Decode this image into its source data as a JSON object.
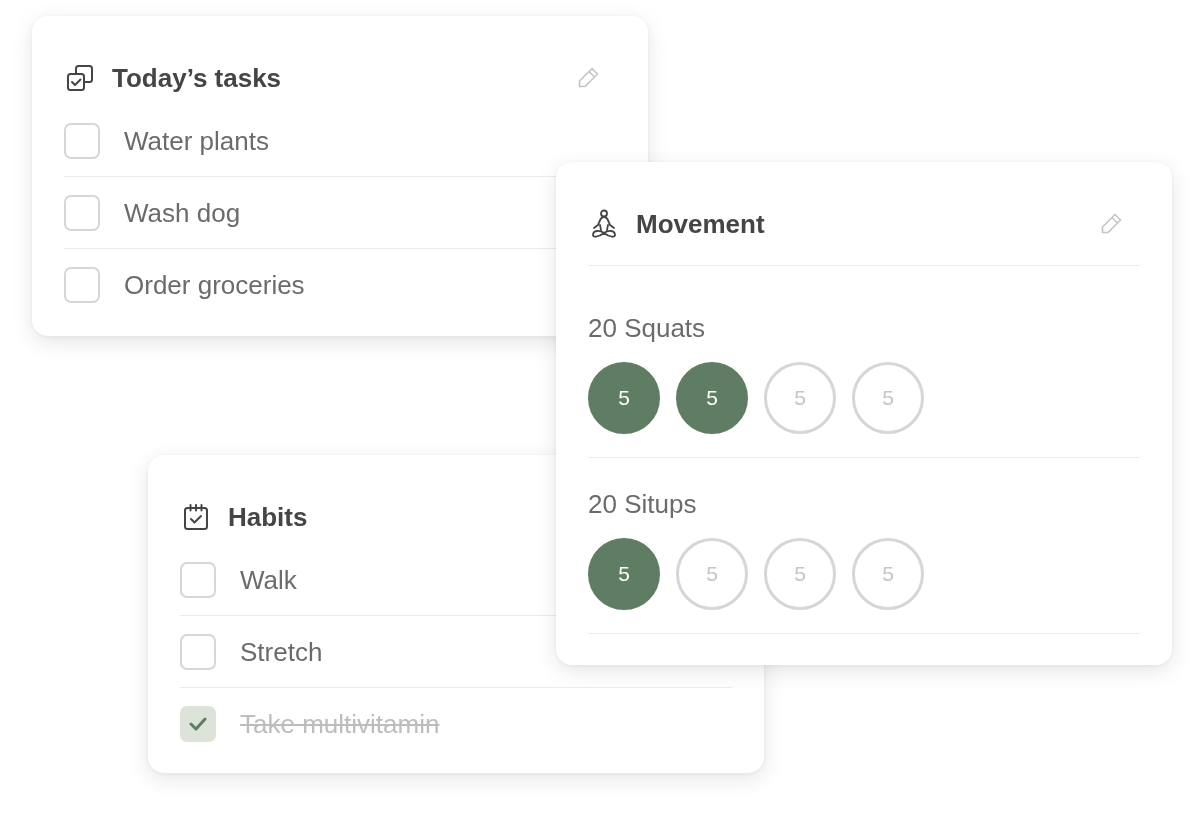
{
  "todays_tasks": {
    "title": "Today’s tasks",
    "items": [
      {
        "label": "Water plants",
        "checked": false
      },
      {
        "label": "Wash dog",
        "checked": false
      },
      {
        "label": "Order groceries",
        "checked": false
      }
    ]
  },
  "movement": {
    "title": "Movement",
    "exercises": [
      {
        "label": "20 Squats",
        "sets": [
          {
            "count": "5",
            "checked": true
          },
          {
            "count": "5",
            "checked": true
          },
          {
            "count": "5",
            "checked": false
          },
          {
            "count": "5",
            "checked": false
          }
        ]
      },
      {
        "label": "20 Situps",
        "sets": [
          {
            "count": "5",
            "checked": true
          },
          {
            "count": "5",
            "checked": false
          },
          {
            "count": "5",
            "checked": false
          },
          {
            "count": "5",
            "checked": false
          }
        ]
      }
    ]
  },
  "habits": {
    "title": "Habits",
    "items": [
      {
        "label": "Walk",
        "checked": false
      },
      {
        "label": "Stretch",
        "checked": false
      },
      {
        "label": "Take multivitamin",
        "checked": true
      }
    ]
  }
}
